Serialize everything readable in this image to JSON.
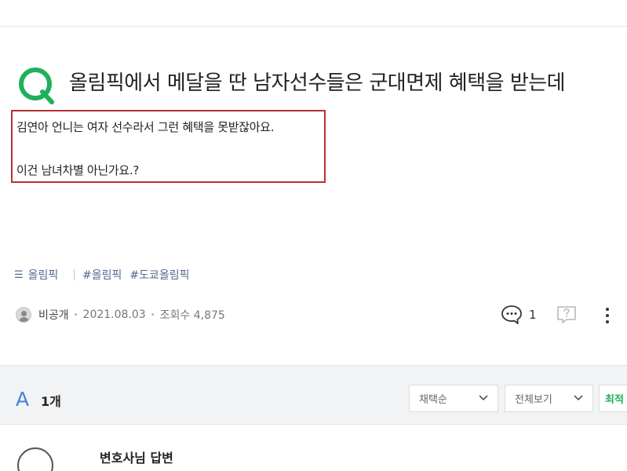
{
  "question": {
    "title": "올림픽에서 메달을 딴 남자선수들은 군대면제 혜택을 받는데",
    "body_lines": [
      "김연아 언니는 여자 선수라서 그런 혜택을 못받잖아요.",
      "이건 남녀차별 아닌가요.?"
    ],
    "q_icon": "question-q-icon"
  },
  "tags": {
    "category_icon": "category-list-icon",
    "category_icon_glyph": "☰",
    "category": "올림픽",
    "items": [
      "#올림픽",
      "#도쿄올림픽"
    ]
  },
  "meta": {
    "author": "비공개",
    "date": "2021.08.03",
    "views_label": "조회수 4,875",
    "comment_count": "1"
  },
  "answers": {
    "a_mark": "A",
    "count_label": "1개",
    "sort_select": "채택순",
    "view_select": "전체보기",
    "latest_button": "최적",
    "first_answer_author": "변호사님 답변"
  },
  "colors": {
    "accent_green": "#1fb05a",
    "highlight_red": "#b93136",
    "answer_blue": "#4a80d8",
    "tag_blue": "#546a91"
  }
}
